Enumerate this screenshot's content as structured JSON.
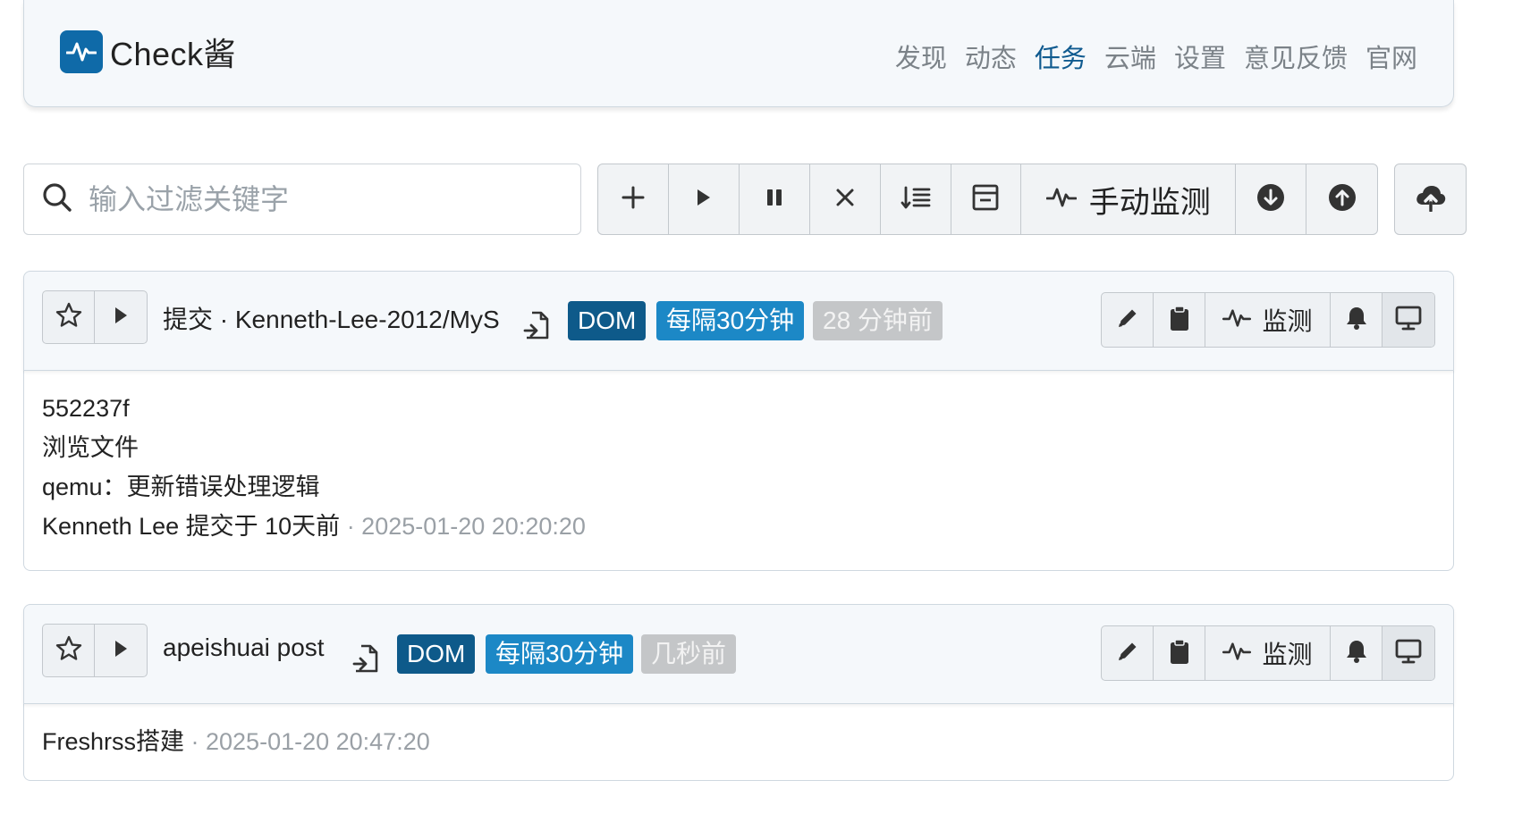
{
  "app": {
    "brand": "Check酱",
    "nav": [
      {
        "label": "发现",
        "active": false
      },
      {
        "label": "动态",
        "active": false
      },
      {
        "label": "任务",
        "active": true
      },
      {
        "label": "云端",
        "active": false
      },
      {
        "label": "设置",
        "active": false
      },
      {
        "label": "意见反馈",
        "active": false
      },
      {
        "label": "官网",
        "active": false
      }
    ]
  },
  "toolbar": {
    "search_placeholder": "输入过滤关键字",
    "search_value": "",
    "manual_monitor_label": "手动监测",
    "icons": [
      "plus-icon",
      "play-icon",
      "pause-icon",
      "close-icon",
      "sort-icon",
      "archive-icon",
      "pulse-icon",
      "download-icon",
      "upload-icon",
      "cloud-upload-icon"
    ]
  },
  "tasks": [
    {
      "title": "提交 · Kenneth-Lee-2012/MyS",
      "type_badge": "DOM",
      "interval_badge": "每隔30分钟",
      "time_badge": "28 分钟前",
      "monitor_label": "监测",
      "body": {
        "lines": [
          "552237f",
          "浏览文件",
          "qemu：更新错误处理逻辑"
        ],
        "footer_text": "Kenneth Lee 提交于 10天前",
        "footer_time": " · 2025-01-20 20:20:20"
      }
    },
    {
      "title": "apeishuai post",
      "type_badge": "DOM",
      "interval_badge": "每隔30分钟",
      "time_badge": "几秒前",
      "monitor_label": "监测",
      "body": {
        "footer_text": "Freshrss搭建",
        "footer_time": " · 2025-01-20 20:47:20"
      }
    }
  ],
  "colors": {
    "brand": "#0f6aa8",
    "nav_active": "#0f5a8f",
    "badge_dom": "#0e5a8a",
    "badge_interval": "#1c88c6",
    "badge_time": "#c4c6c8"
  }
}
